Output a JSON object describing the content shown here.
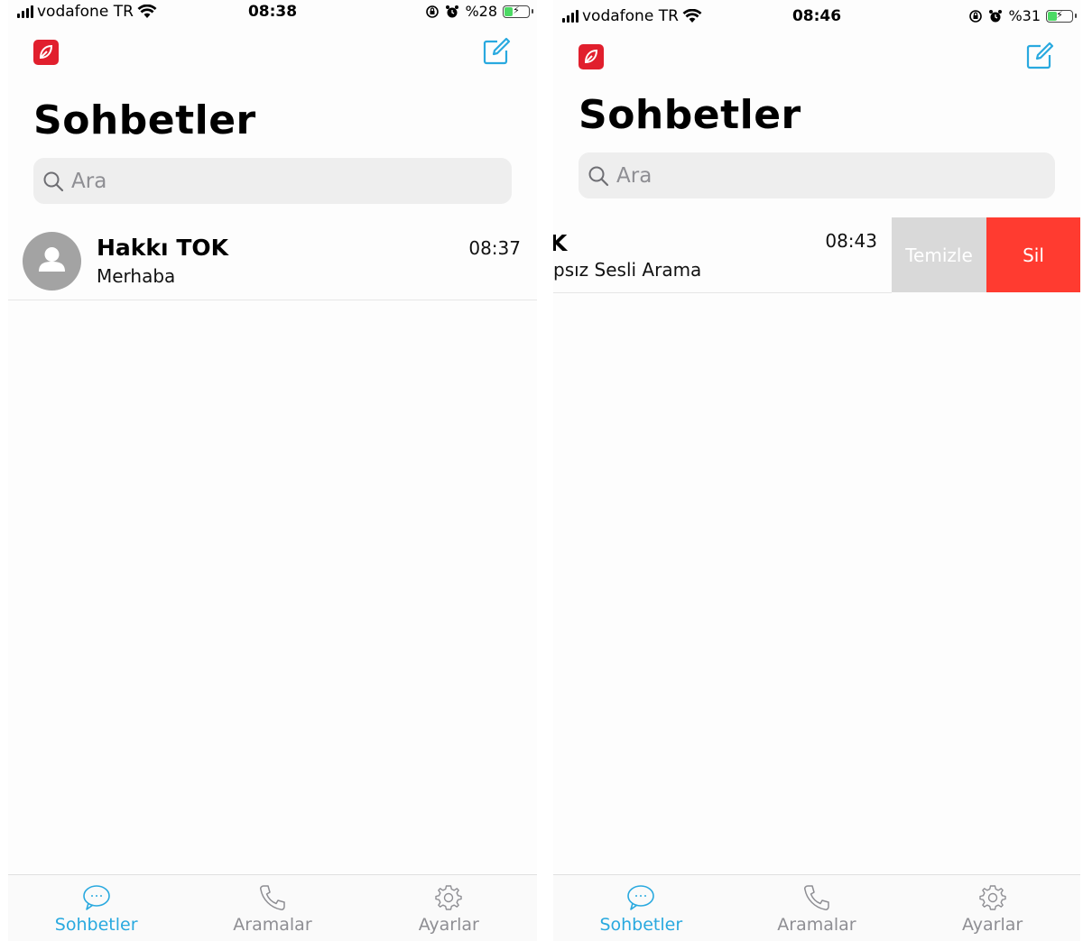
{
  "screens": [
    {
      "status": {
        "carrier": "vodafone TR",
        "time": "08:38",
        "battery": "%28"
      },
      "title": "Sohbetler",
      "search": {
        "placeholder": "Ara"
      },
      "chat": {
        "name": "Hakkı TOK",
        "message": "Merhaba",
        "time": "08:37"
      },
      "tabs": [
        "Sohbetler",
        "Aramalar",
        "Ayarlar"
      ]
    },
    {
      "status": {
        "carrier": "vodafone TR",
        "time": "08:46",
        "battery": "%31"
      },
      "title": "Sohbetler",
      "search": {
        "placeholder": "Ara"
      },
      "chat": {
        "name_visible": "K",
        "message_visible": "psız Sesli Arama",
        "time": "08:43"
      },
      "swipe_actions": {
        "clear": "Temizle",
        "delete": "Sil"
      },
      "tabs": [
        "Sohbetler",
        "Aramalar",
        "Ayarlar"
      ]
    }
  ],
  "colors": {
    "accent": "#29a9df",
    "brand": "#e11f2d",
    "delete": "#ff3b30",
    "clear": "#d9d9d9"
  }
}
